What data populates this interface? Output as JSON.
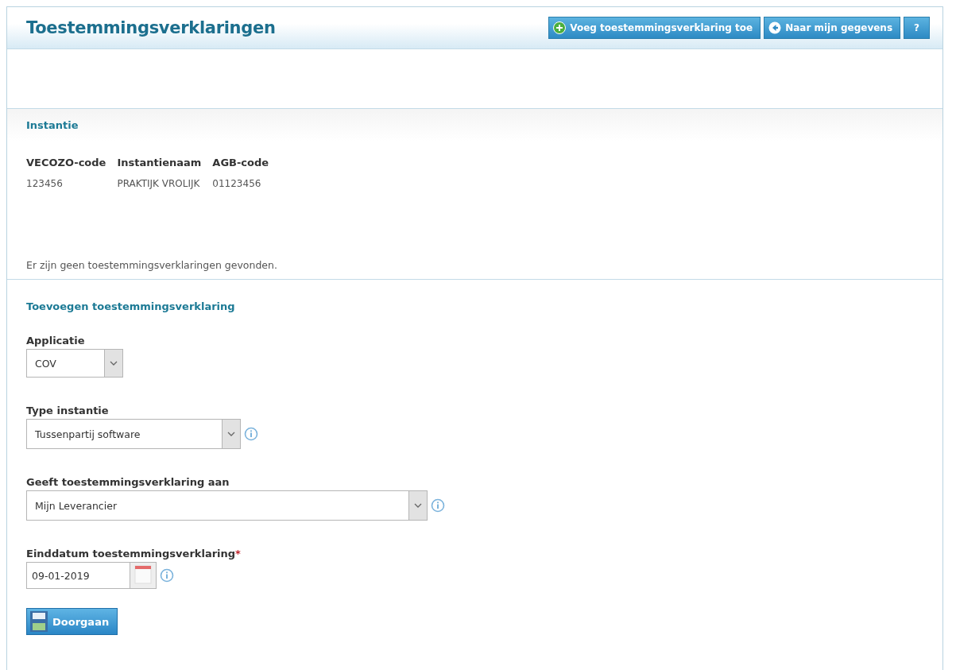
{
  "page": {
    "title": "Toestemmingsverklaringen",
    "actions": [
      {
        "kind": "add",
        "label": "Voeg toestemmingsverklaring toe"
      },
      {
        "kind": "back",
        "label": "Naar mijn gegevens"
      },
      {
        "kind": "help",
        "label": "?"
      }
    ]
  },
  "instance": {
    "heading": "Instantie",
    "columns": [
      "VECOZO-code",
      "Instantienaam",
      "AGB-code"
    ],
    "values": [
      "123456",
      "PRAKTIJK VROLIJK",
      "01123456"
    ]
  },
  "message": "Er zijn geen toestemmingsverklaringen gevonden.",
  "form": {
    "heading": "Toevoegen toestemmingsverklaring",
    "fields": [
      {
        "kind": "select",
        "label": "Applicatie",
        "value": "COV",
        "info": false
      },
      {
        "kind": "select",
        "label": "Type instantie",
        "value": "Tussenpartij software",
        "info": true
      },
      {
        "kind": "select",
        "label": "Geeft toestemmingsverklaring aan",
        "value": "Mijn Leverancier",
        "info": true
      },
      {
        "kind": "date",
        "label": "Einddatum toestemmingsverklaring",
        "required_mark": "*",
        "value": "09-01-2019",
        "info": true
      }
    ],
    "submit": {
      "label": "Doorgaan"
    }
  }
}
